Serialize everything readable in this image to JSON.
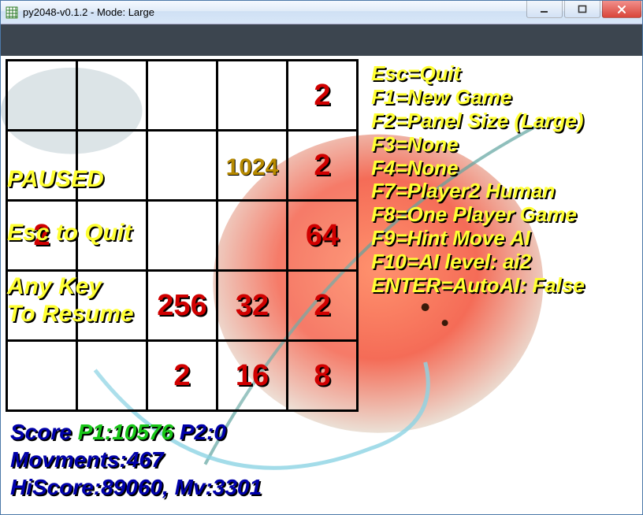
{
  "window": {
    "title": "py2048-v0.1.2 - Mode: Large"
  },
  "board": {
    "rows": 5,
    "cols": 5,
    "cells": [
      [
        null,
        null,
        null,
        null,
        {
          "v": "2",
          "cls": "c-grey"
        }
      ],
      [
        null,
        null,
        null,
        {
          "v": "1024",
          "cls": "c-red",
          "tcls": "c-1024"
        },
        {
          "v": "2",
          "cls": "c-grey"
        }
      ],
      [
        {
          "v": "2",
          "cls": "c-grey"
        },
        null,
        null,
        null,
        {
          "v": "64",
          "cls": "c-violet"
        }
      ],
      [
        null,
        null,
        {
          "v": "256",
          "cls": "c-salmon"
        },
        {
          "v": "32",
          "cls": "c-yellow"
        },
        {
          "v": "2",
          "cls": "c-grey"
        }
      ],
      [
        null,
        null,
        {
          "v": "2",
          "cls": "c-grey"
        },
        {
          "v": "16",
          "cls": "c-teal"
        },
        {
          "v": "8",
          "cls": "c-blue"
        }
      ]
    ]
  },
  "overlay": {
    "paused": "PAUSED",
    "esc": "Esc to Quit",
    "resume": "Any Key\nTo Resume"
  },
  "help": [
    "Esc=Quit",
    "F1=New Game",
    "F2=Panel Size (Large)",
    "F3=None",
    "F4=None",
    "F7=Player2 Human",
    "F8=One Player Game",
    "F9=Hint Move AI",
    "F10=AI level: ai2",
    "ENTER=AutoAI: False"
  ],
  "status": {
    "score_label": "Score ",
    "p1": "P1:10576",
    "p2": "  P2:0",
    "movements": "Movments:467",
    "hiscore": "HiScore:89060, Mv:3301"
  }
}
